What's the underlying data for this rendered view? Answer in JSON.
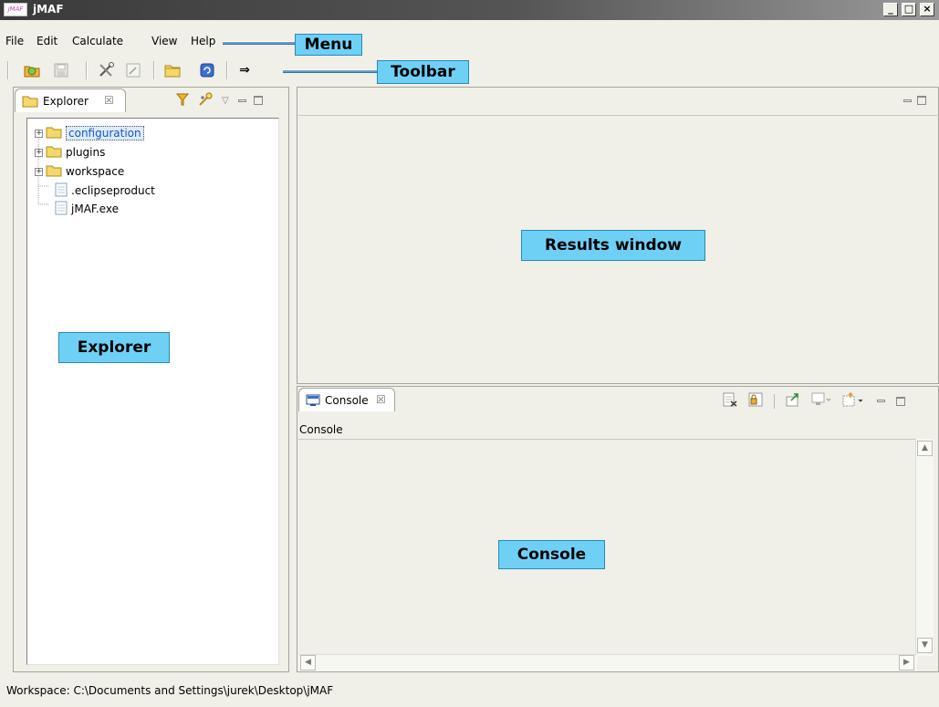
{
  "window": {
    "title": "jMAF",
    "app_icon_text": "jMAF"
  },
  "menu": {
    "items": [
      "File",
      "Edit",
      "Calculate",
      "View",
      "Help"
    ]
  },
  "toolbar": {
    "arrow_label": "⇒"
  },
  "explorer": {
    "tab_label": "Explorer",
    "tree": [
      {
        "label": "configuration",
        "type": "folder",
        "expandable": true,
        "selected": true
      },
      {
        "label": "plugins",
        "type": "folder",
        "expandable": true,
        "selected": false
      },
      {
        "label": "workspace",
        "type": "folder",
        "expandable": true,
        "selected": false
      },
      {
        "label": ".eclipseproduct",
        "type": "file",
        "expandable": false,
        "selected": false
      },
      {
        "label": "jMAF.exe",
        "type": "file",
        "expandable": false,
        "selected": false
      }
    ]
  },
  "console": {
    "tab_label": "Console",
    "title": "Console"
  },
  "callouts": {
    "menu": "Menu",
    "toolbar": "Toolbar",
    "explorer": "Explorer",
    "results": "Results window",
    "console": "Console"
  },
  "status": {
    "text": "Workspace: C:\\Documents and Settings\\jurek\\Desktop\\jMAF"
  },
  "colors": {
    "callout_bg": "#6fd0f5",
    "selection": "#dcecfc",
    "folder": "#f5d86a"
  }
}
